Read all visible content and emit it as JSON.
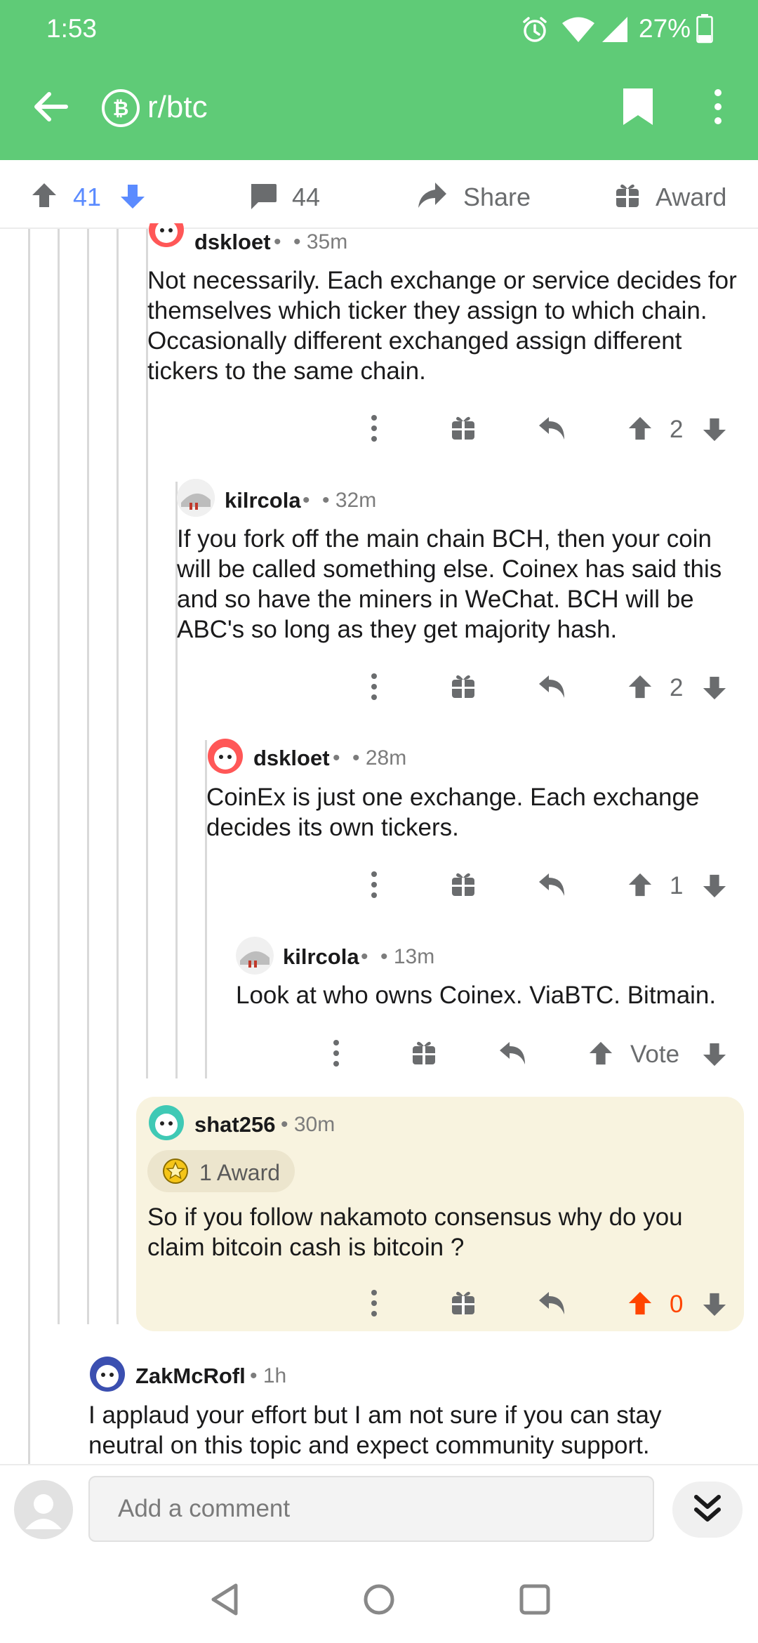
{
  "status_bar": {
    "time": "1:53",
    "battery": "27%"
  },
  "toolbar": {
    "subreddit": "r/btc",
    "icons": [
      "back-arrow-icon",
      "bitcoin-icon",
      "bookmark-icon",
      "more-vert-icon"
    ]
  },
  "post_actions": {
    "score": "41",
    "comments": "44",
    "share_label": "Share",
    "award_label": "Award"
  },
  "comments": [
    {
      "user": "dskloet",
      "sep": "•",
      "time": "• 35m",
      "body": "Not necessarily. Each exchange or service decides for themselves which ticker they assign to which chain. Occasionally different exchanged assign different tickers to the same chain.",
      "score": "2"
    },
    {
      "user": "kilrcola",
      "sep": "•",
      "time": "• 32m",
      "body": "If you fork off the main chain BCH, then your coin will be called something else. Coinex has said this and so have the miners in WeChat. BCH will be ABC's so long as they get majority hash.",
      "score": "2"
    },
    {
      "user": "dskloet",
      "sep": "•",
      "time": "• 28m",
      "body": "CoinEx is just one exchange. Each exchange decides its own tickers.",
      "score": "1"
    },
    {
      "user": "kilrcola",
      "sep": "•",
      "time": "• 13m",
      "body": "Look at who owns Coinex. ViaBTC. Bitmain.",
      "score": "Vote"
    },
    {
      "user": "shat256",
      "time": "• 30m",
      "award": "1 Award",
      "body": "So if you follow nakamoto consensus  why do you claim bitcoin cash is bitcoin ?",
      "score": "0",
      "upvote_color": "#ff4500"
    },
    {
      "user": "ZakMcRofl",
      "time": "• 1h",
      "body": "I applaud your effort but I am not sure if you can stay neutral on this topic and expect community support."
    }
  ],
  "bottom": {
    "placeholder": "Add a comment"
  },
  "nav": [
    "back-triangle-icon",
    "home-circle-icon",
    "recents-square-icon"
  ],
  "colors": {
    "header": "#5fcb77",
    "upvoted": "#ff4500",
    "downvote_blue": "#7193ff",
    "highlight": "#f8f3df"
  }
}
